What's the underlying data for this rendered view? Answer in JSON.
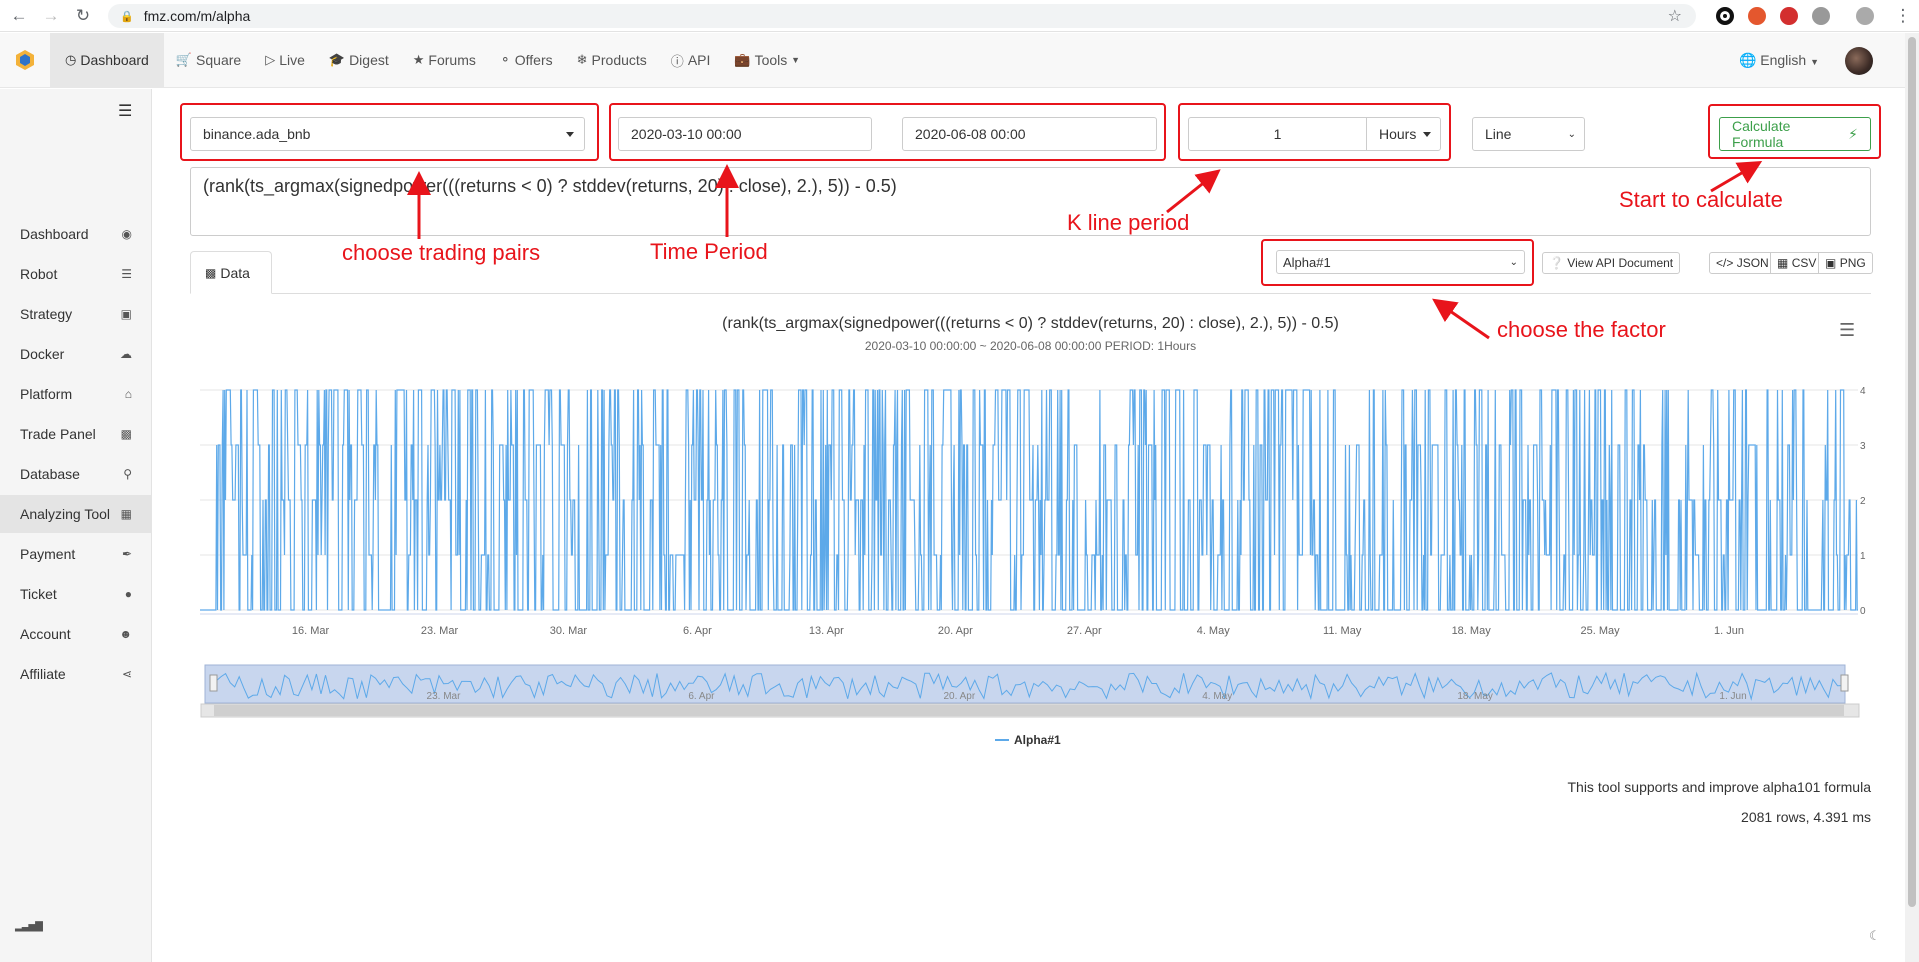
{
  "browser": {
    "url": "fmz.com/m/alpha"
  },
  "nav": {
    "items": [
      {
        "label": "Dashboard",
        "icon": "clock-icon"
      },
      {
        "label": "Square",
        "icon": "cart-icon"
      },
      {
        "label": "Live",
        "icon": "play-icon"
      },
      {
        "label": "Digest",
        "icon": "graduation-icon"
      },
      {
        "label": "Forums",
        "icon": "star-icon"
      },
      {
        "label": "Offers",
        "icon": "binoculars-icon"
      },
      {
        "label": "Products",
        "icon": "fire-icon"
      },
      {
        "label": "API",
        "icon": "info-icon"
      },
      {
        "label": "Tools",
        "icon": "briefcase-icon"
      }
    ],
    "language": "English"
  },
  "sidebar": {
    "items": [
      {
        "label": "Dashboard",
        "icon": "dashboard-icon"
      },
      {
        "label": "Robot",
        "icon": "tasks-icon"
      },
      {
        "label": "Strategy",
        "icon": "cube-icon"
      },
      {
        "label": "Docker",
        "icon": "cloud-icon"
      },
      {
        "label": "Platform",
        "icon": "bank-icon"
      },
      {
        "label": "Trade Panel",
        "icon": "bar-chart-icon"
      },
      {
        "label": "Database",
        "icon": "search-icon"
      },
      {
        "label": "Analyzing Tool",
        "icon": "calculator-icon"
      },
      {
        "label": "Payment",
        "icon": "plug-icon"
      },
      {
        "label": "Ticket",
        "icon": "comment-icon"
      },
      {
        "label": "Account",
        "icon": "user-circle-icon"
      },
      {
        "label": "Affiliate",
        "icon": "share-icon"
      }
    ],
    "active": "Analyzing Tool"
  },
  "controls": {
    "pair": "binance.ada_bnb",
    "start_date": "2020-03-10 00:00",
    "end_date": "2020-06-08 00:00",
    "period_value": "1",
    "period_unit": "Hours",
    "chart_style": "Line",
    "calculate_label": "Calculate Formula",
    "formula": "(rank(ts_argmax(signedpower(((returns < 0) ? stddev(returns, 20) : close), 2.), 5)) - 0.5)",
    "factor": "Alpha#1",
    "api_doc_label": "View API Document",
    "export": [
      "JSON",
      "CSV",
      "PNG"
    ],
    "tab_label": "Data"
  },
  "annotations": {
    "pairs": "choose trading pairs",
    "time": "Time Period",
    "kline": "K line period",
    "calc": "Start to calculate",
    "factor": "choose the factor"
  },
  "chart_data": {
    "type": "line",
    "title": "(rank(ts_argmax(signedpower(((returns < 0) ? stddev(returns, 20) : close), 2.), 5)) - 0.5)",
    "subtitle": "2020-03-10 00:00:00 ~ 2020-06-08 00:00:00 PERIOD: 1Hours",
    "xlabel": "",
    "ylabel": "",
    "x_range": [
      "2020-03-10",
      "2020-06-08"
    ],
    "ylim": [
      0,
      4
    ],
    "yticks": [
      "0",
      "1",
      "2",
      "3",
      "4"
    ],
    "x_ticks": [
      "16. Mar",
      "23. Mar",
      "30. Mar",
      "6. Apr",
      "13. Apr",
      "20. Apr",
      "27. Apr",
      "4. May",
      "11. May",
      "18. May",
      "25. May",
      "1. Jun"
    ],
    "navigator_ticks": [
      "23. Mar",
      "6. Apr",
      "20. Apr",
      "4. May",
      "18. May",
      "1. Jun"
    ],
    "series": [
      {
        "name": "Alpha#1",
        "values_range": [
          0,
          4
        ],
        "color": "#5da9e9"
      }
    ],
    "grid": true,
    "legend": "bottom-center"
  },
  "footer": {
    "note": "This tool supports and improve alpha101 formula",
    "stats": "2081 rows, 4.391 ms"
  },
  "colors": {
    "accent_green": "#3c9f4a",
    "annotation_red": "#e8141b",
    "series_blue": "#5da9e9"
  }
}
